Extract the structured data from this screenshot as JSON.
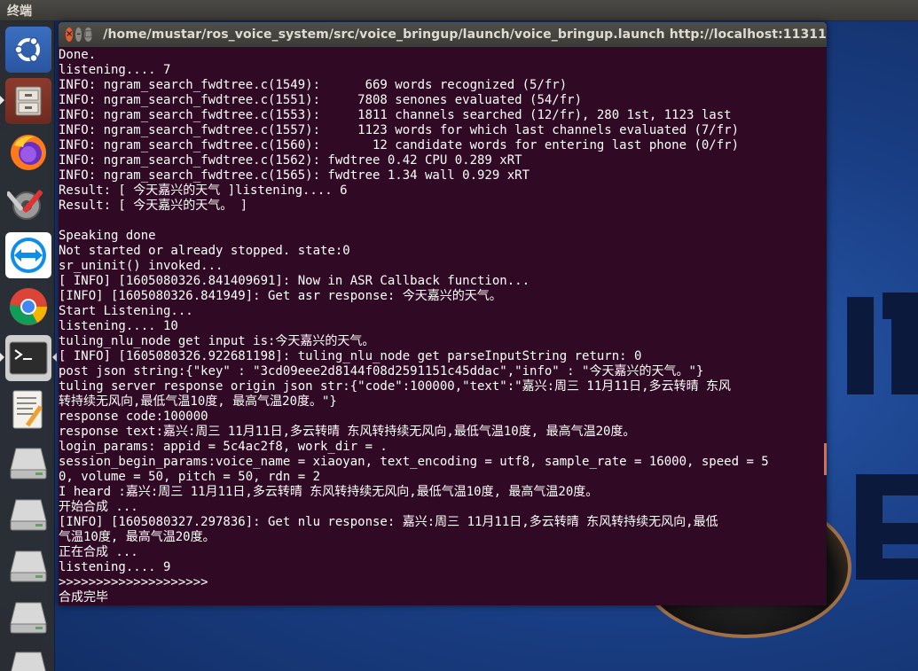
{
  "top_panel": {
    "title": "终端"
  },
  "launcher": {
    "items": [
      {
        "name": "ubuntu-dash-icon",
        "label": "Search your computer"
      },
      {
        "name": "files-icon",
        "label": "Files"
      },
      {
        "name": "firefox-icon",
        "label": "Firefox Web Browser"
      },
      {
        "name": "system-settings-icon",
        "label": "System Settings"
      },
      {
        "name": "teamviewer-icon",
        "label": "TeamViewer"
      },
      {
        "name": "chrome-icon",
        "label": "Google Chrome"
      },
      {
        "name": "terminal-icon",
        "label": "Terminal"
      },
      {
        "name": "text-editor-icon",
        "label": "Text Editor"
      },
      {
        "name": "drive-icon",
        "label": "Drive"
      },
      {
        "name": "drive-icon",
        "label": "Drive"
      },
      {
        "name": "drive-icon",
        "label": "Drive"
      },
      {
        "name": "drive-icon",
        "label": "Drive"
      },
      {
        "name": "drive-icon",
        "label": "Drive"
      }
    ]
  },
  "terminal": {
    "title": "/home/mustar/ros_voice_system/src/voice_bringup/launch/voice_bringup.launch http://localhost:11311",
    "buttons": {
      "close": "×",
      "minimize": "–",
      "maximize": "□"
    },
    "lines": [
      "Done.",
      "listening.... 7",
      "INFO: ngram_search_fwdtree.c(1549):      669 words recognized (5/fr)",
      "INFO: ngram_search_fwdtree.c(1551):     7808 senones evaluated (54/fr)",
      "INFO: ngram_search_fwdtree.c(1553):     1811 channels searched (12/fr), 280 1st, 1123 last",
      "INFO: ngram_search_fwdtree.c(1557):     1123 words for which last channels evaluated (7/fr)",
      "INFO: ngram_search_fwdtree.c(1560):       12 candidate words for entering last phone (0/fr)",
      "INFO: ngram_search_fwdtree.c(1562): fwdtree 0.42 CPU 0.289 xRT",
      "INFO: ngram_search_fwdtree.c(1565): fwdtree 1.34 wall 0.929 xRT",
      "Result: [ 今天嘉兴的天气 ]listening.... 6",
      "Result: [ 今天嘉兴的天气。 ]",
      "",
      "Speaking done",
      "Not started or already stopped. state:0",
      "sr_uninit() invoked...",
      "[ INFO] [1605080326.841409691]: Now in ASR Callback function...",
      "[INFO] [1605080326.841949]: Get asr response: 今天嘉兴的天气。",
      "Start Listening...",
      "listening.... 10",
      "tuling_nlu_node get input is:今天嘉兴的天气。",
      "[ INFO] [1605080326.922681198]: tuling_nlu_node get parseInputString return: 0",
      "post json string:{\"key\" : \"3cd09eee2d8144f08d2591151c45ddac\",\"info\" : \"今天嘉兴的天气。\"}",
      "tuling server response origin json str:{\"code\":100000,\"text\":\"嘉兴:周三 11月11日,多云转晴 东风",
      "转持续无风向,最低气温10度, 最高气温20度。\"}",
      "response code:100000",
      "response text:嘉兴:周三 11月11日,多云转晴 东风转持续无风向,最低气温10度, 最高气温20度。",
      "login_params: appid = 5c4ac2f8, work_dir = .",
      "session_begin_params:voice_name = xiaoyan, text_encoding = utf8, sample_rate = 16000, speed = 5",
      "0, volume = 50, pitch = 50, rdn = 2",
      "I heard :嘉兴:周三 11月11日,多云转晴 东风转持续无风向,最低气温10度, 最高气温20度。",
      "开始合成 ...",
      "[INFO] [1605080327.297836]: Get nlu response: 嘉兴:周三 11月11日,多云转晴 东风转持续无风向,最低",
      "气温10度, 最高气温20度。",
      "正在合成 ...",
      "listening.... 9",
      ">>>>>>>>>>>>>>>>>>>>",
      "合成完毕"
    ]
  },
  "colors": {
    "terminal_bg": "#300a24",
    "terminal_fg": "#ffffff",
    "close_button": "#e05e33"
  }
}
